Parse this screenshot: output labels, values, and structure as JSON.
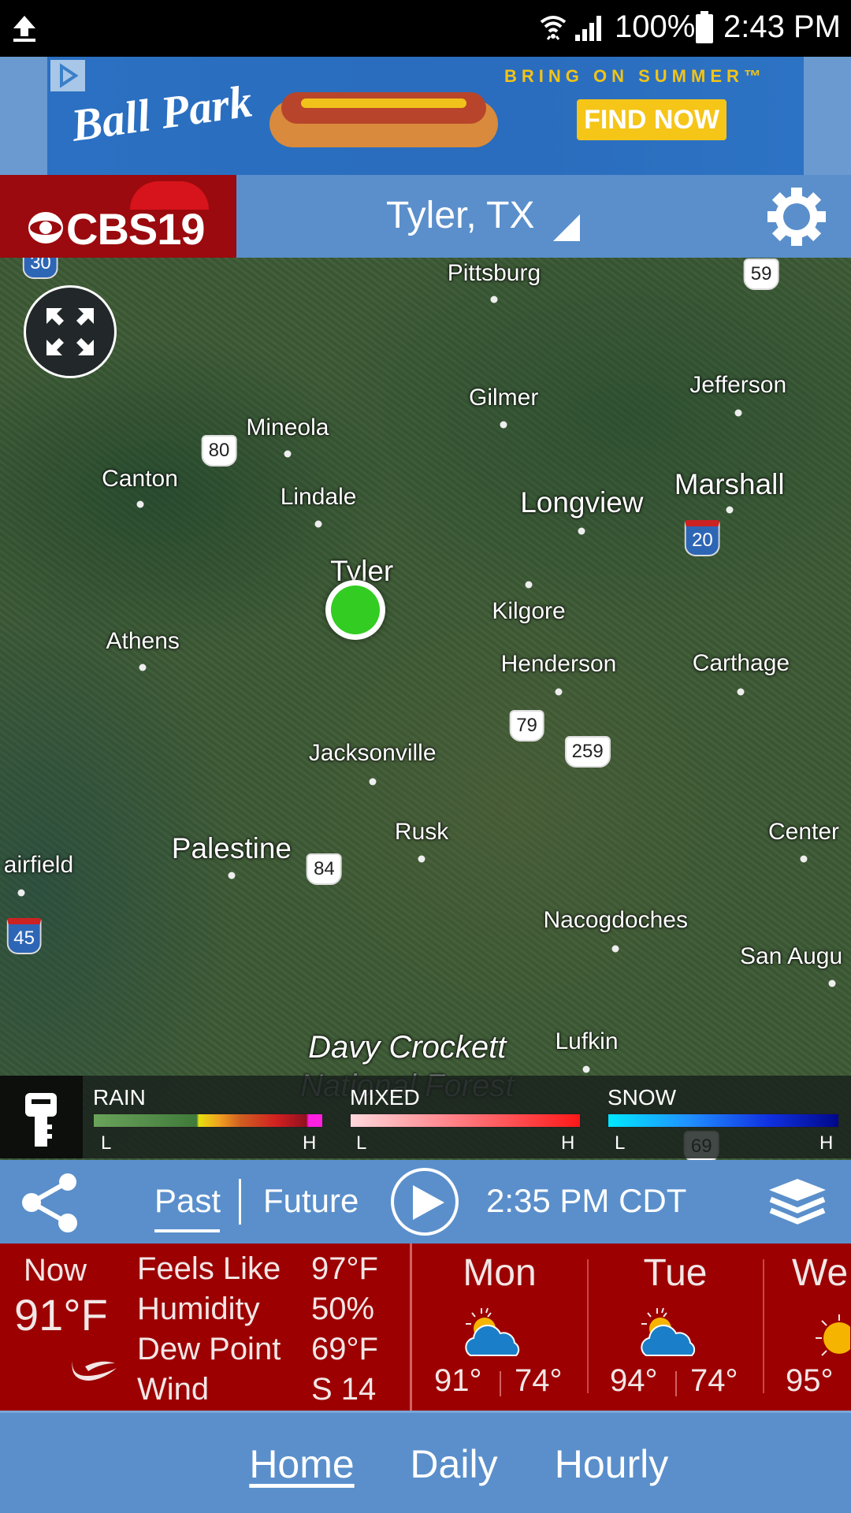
{
  "status_bar": {
    "battery": "100%",
    "time": "2:43 PM",
    "icons": [
      "upload-icon",
      "wifi-icon",
      "signal-icon",
      "battery-icon"
    ]
  },
  "ad": {
    "brand": "Ball Park",
    "tagline": "BRING ON SUMMER™",
    "cta": "FIND NOW"
  },
  "header": {
    "logo": "CBS19",
    "location": "Tyler, TX"
  },
  "map": {
    "cities": [
      "Pittsburg",
      "Gilmer",
      "Jefferson",
      "Mineola",
      "Canton",
      "Lindale",
      "Longview",
      "Marshall",
      "Tyler",
      "Kilgore",
      "Athens",
      "Henderson",
      "Carthage",
      "Jacksonville",
      "Rusk",
      "Palestine",
      "Center",
      "airfield",
      "Nacogdoches",
      "San Augu",
      "Lufkin"
    ],
    "forest": [
      "Davy Crockett",
      "National Forest"
    ],
    "highways": [
      "30",
      "59",
      "80",
      "20",
      "79",
      "259",
      "84",
      "45",
      "69"
    ],
    "location_marker_color": "#33cc22"
  },
  "legend": {
    "rain": {
      "label": "RAIN",
      "low": "L",
      "high": "H"
    },
    "mixed": {
      "label": "MIXED",
      "low": "L",
      "high": "H"
    },
    "snow": {
      "label": "SNOW",
      "low": "L",
      "high": "H"
    }
  },
  "controls": {
    "past": "Past",
    "future": "Future",
    "time": "2:35 PM CDT",
    "active": "Past"
  },
  "current": {
    "now_label": "Now",
    "temp": "91°F",
    "rows": [
      {
        "label": "Feels Like",
        "value": "97°F"
      },
      {
        "label": "Humidity",
        "value": "50%"
      },
      {
        "label": "Dew Point",
        "value": "69°F"
      },
      {
        "label": "Wind",
        "value": "S 14"
      }
    ]
  },
  "forecast": [
    {
      "day": "Mon",
      "icon": "partly-cloudy-icon",
      "high": "91°",
      "low": "74°"
    },
    {
      "day": "Tue",
      "icon": "partly-cloudy-icon",
      "high": "94°",
      "low": "74°"
    },
    {
      "day": "We",
      "icon": "sunny-icon",
      "high": "95°"
    }
  ],
  "nav": {
    "items": [
      "Home",
      "Daily",
      "Hourly"
    ],
    "active": "Home"
  }
}
